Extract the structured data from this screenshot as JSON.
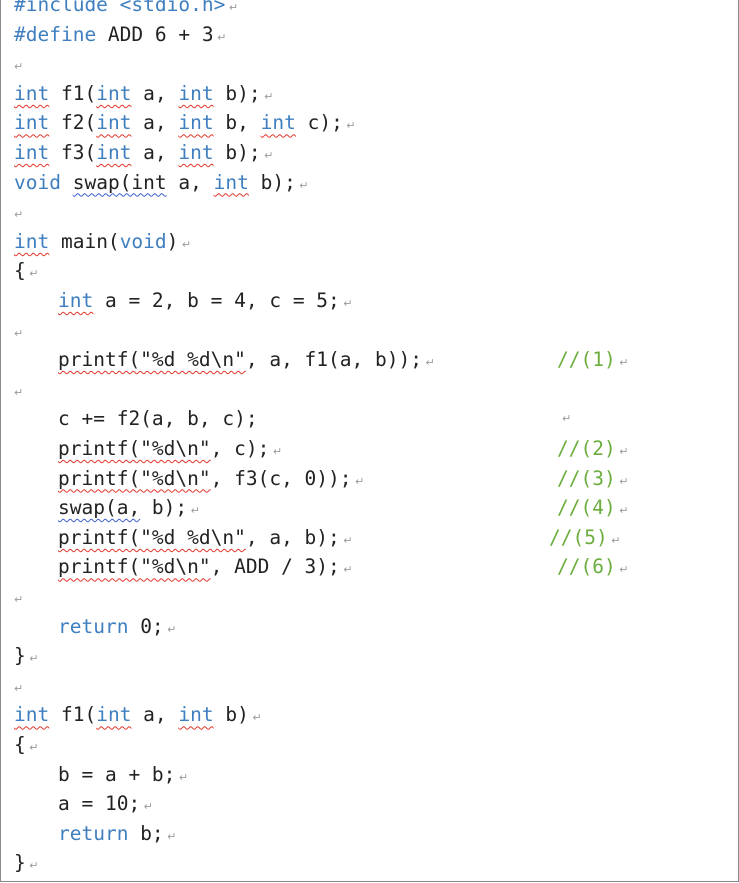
{
  "code_lines": [
    {
      "indent": 0,
      "tokens": [
        {
          "t": "#include <stdio.h>",
          "c": "kw"
        }
      ],
      "mark": true
    },
    {
      "indent": 0,
      "tokens": [
        {
          "t": "#define",
          "c": "kw"
        },
        {
          "t": " ADD 6 + 3"
        }
      ],
      "mark": true
    },
    {
      "indent": 0,
      "tokens": [],
      "mark": true
    },
    {
      "indent": 0,
      "tokens": [
        {
          "t": "int",
          "c": "kw",
          "sq": "red"
        },
        {
          "t": " f1("
        },
        {
          "t": "int",
          "c": "kw",
          "sq": "red"
        },
        {
          "t": " a, "
        },
        {
          "t": "int",
          "c": "kw",
          "sq": "red"
        },
        {
          "t": " b);"
        }
      ],
      "mark": true
    },
    {
      "indent": 0,
      "tokens": [
        {
          "t": "int",
          "c": "kw",
          "sq": "red"
        },
        {
          "t": " f2("
        },
        {
          "t": "int",
          "c": "kw",
          "sq": "red"
        },
        {
          "t": " a, "
        },
        {
          "t": "int",
          "c": "kw",
          "sq": "red"
        },
        {
          "t": " b, "
        },
        {
          "t": "int",
          "c": "kw",
          "sq": "red"
        },
        {
          "t": " c);"
        }
      ],
      "mark": true
    },
    {
      "indent": 0,
      "tokens": [
        {
          "t": "int",
          "c": "kw",
          "sq": "red"
        },
        {
          "t": " f3("
        },
        {
          "t": "int",
          "c": "kw",
          "sq": "red"
        },
        {
          "t": " a, "
        },
        {
          "t": "int",
          "c": "kw",
          "sq": "red"
        },
        {
          "t": " b);"
        }
      ],
      "mark": true
    },
    {
      "indent": 0,
      "tokens": [
        {
          "t": "void",
          "c": "kw"
        },
        {
          "t": " "
        },
        {
          "t": "swap(int",
          "sq": "blue"
        },
        {
          "t": " a, "
        },
        {
          "t": "int",
          "c": "kw",
          "sq": "red"
        },
        {
          "t": " b);"
        }
      ],
      "mark": true
    },
    {
      "indent": 0,
      "tokens": [],
      "mark": true
    },
    {
      "indent": 0,
      "tokens": [
        {
          "t": "int",
          "c": "kw",
          "sq": "red"
        },
        {
          "t": " main("
        },
        {
          "t": "void",
          "c": "kw"
        },
        {
          "t": ")"
        }
      ],
      "mark": true
    },
    {
      "indent": 0,
      "tokens": [
        {
          "t": "{"
        }
      ],
      "mark": true
    },
    {
      "indent": 1,
      "tokens": [
        {
          "t": "int",
          "c": "kw",
          "sq": "red"
        },
        {
          "t": " a = 2, b = 4, c = 5;"
        }
      ],
      "mark": true
    },
    {
      "indent": 0,
      "tokens": [],
      "mark": true
    },
    {
      "indent": 1,
      "tokens": [
        {
          "t": "printf(\"%d %d\\n\"",
          "sq": "red"
        },
        {
          "t": ", a, f1(a, b));"
        }
      ],
      "comment": "//(1)",
      "mark": true
    },
    {
      "indent": 0,
      "tokens": [],
      "mark": true
    },
    {
      "indent": 1,
      "tokens": [
        {
          "t": "c += f2(a, b, c);"
        }
      ],
      "mark_far": true
    },
    {
      "indent": 1,
      "tokens": [
        {
          "t": "printf(\"%d\\n\"",
          "sq": "red"
        },
        {
          "t": ", c);"
        }
      ],
      "comment": "//(2)",
      "mark": true
    },
    {
      "indent": 1,
      "tokens": [
        {
          "t": "printf(\"%d\\n\"",
          "sq": "red"
        },
        {
          "t": ", f3(c, 0));"
        }
      ],
      "comment": "//(3)",
      "mark": true
    },
    {
      "indent": 1,
      "tokens": [
        {
          "t": "swap(a,",
          "sq": "blue"
        },
        {
          "t": " b);"
        }
      ],
      "comment": "//(4)",
      "mark": true
    },
    {
      "indent": 1,
      "tokens": [
        {
          "t": "printf(\"%d %d\\n\"",
          "sq": "red"
        },
        {
          "t": ", a, b);"
        }
      ],
      "comment": "//(5)",
      "comment_shift": true,
      "mark": true
    },
    {
      "indent": 1,
      "tokens": [
        {
          "t": "printf(\"%d\\n\"",
          "sq": "red"
        },
        {
          "t": ", ADD / 3);"
        }
      ],
      "comment": "//(6)",
      "mark": true
    },
    {
      "indent": 0,
      "tokens": [],
      "mark": true
    },
    {
      "indent": 1,
      "tokens": [
        {
          "t": "return",
          "c": "kw"
        },
        {
          "t": " 0;"
        }
      ],
      "mark": true
    },
    {
      "indent": 0,
      "tokens": [
        {
          "t": "}"
        }
      ],
      "mark": true
    },
    {
      "indent": 0,
      "tokens": [],
      "mark": true
    },
    {
      "indent": 0,
      "tokens": [
        {
          "t": "int",
          "c": "kw",
          "sq": "red"
        },
        {
          "t": " f1("
        },
        {
          "t": "int",
          "c": "kw",
          "sq": "red"
        },
        {
          "t": " a, "
        },
        {
          "t": "int",
          "c": "kw",
          "sq": "red"
        },
        {
          "t": " b)"
        }
      ],
      "mark": true
    },
    {
      "indent": 0,
      "tokens": [
        {
          "t": "{"
        }
      ],
      "mark": true
    },
    {
      "indent": 1,
      "tokens": [
        {
          "t": "b = a + b;"
        }
      ],
      "mark": true
    },
    {
      "indent": 1,
      "tokens": [
        {
          "t": "a = 10;"
        }
      ],
      "mark": true
    },
    {
      "indent": 1,
      "tokens": [
        {
          "t": "return",
          "c": "kw"
        },
        {
          "t": " b;"
        }
      ],
      "mark": true
    },
    {
      "indent": 0,
      "tokens": [
        {
          "t": "}"
        }
      ],
      "mark": true
    }
  ],
  "paragraph_mark": "↵",
  "colors": {
    "keyword": "#3f7fbf",
    "comment": "#6cae3e",
    "text": "#222222",
    "spell_red": "#e0352b",
    "spell_blue": "#3a5fd0"
  }
}
